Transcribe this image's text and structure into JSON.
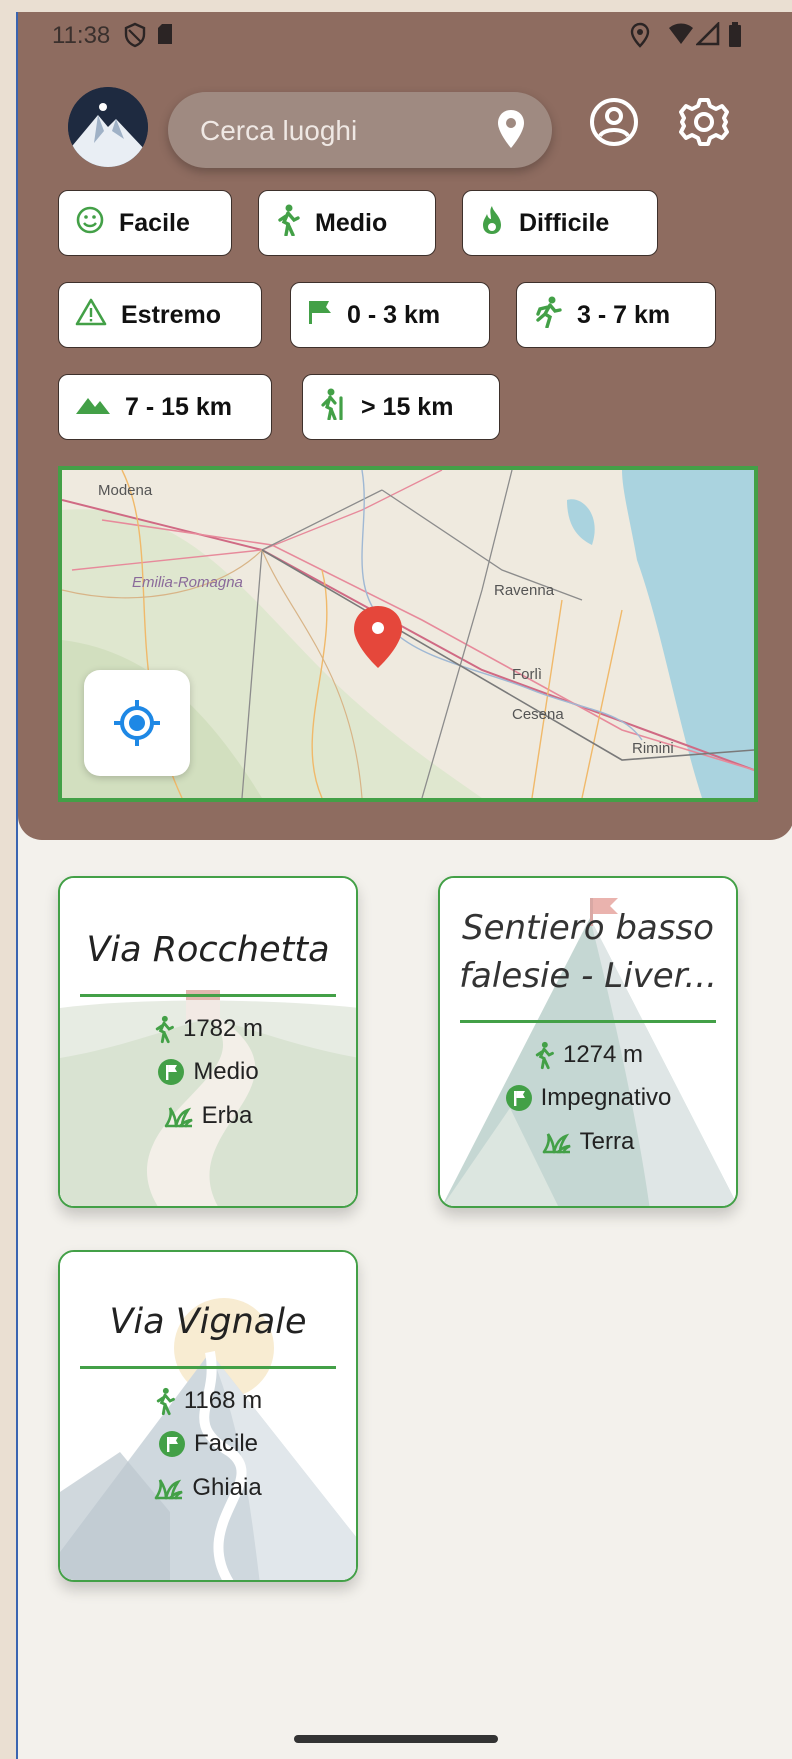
{
  "status_bar": {
    "time": "11:38"
  },
  "search": {
    "placeholder": "Cerca luoghi"
  },
  "filters": [
    {
      "label": "Facile",
      "icon": "smile-icon"
    },
    {
      "label": "Medio",
      "icon": "walk-icon"
    },
    {
      "label": "Difficile",
      "icon": "fire-icon"
    },
    {
      "label": "Estremo",
      "icon": "warning-icon"
    },
    {
      "label": "0 - 3 km",
      "icon": "flag-icon"
    },
    {
      "label": "3 - 7 km",
      "icon": "run-icon"
    },
    {
      "label": "7 - 15 km",
      "icon": "mountain-icon"
    },
    {
      "label": "> 15 km",
      "icon": "hike-icon"
    }
  ],
  "map": {
    "labels": [
      "Modena",
      "Emilia-Romagna",
      "Ravenna",
      "Forlì",
      "Cesena",
      "Rimini"
    ]
  },
  "trails": [
    {
      "name": "Via Rocchetta",
      "length": "1782 m",
      "difficulty": "Medio",
      "terrain": "Erba"
    },
    {
      "name": "Sentiero basso falesie - Liver...",
      "length": "1274 m",
      "difficulty": "Impegnativo",
      "terrain": "Terra"
    },
    {
      "name": "Via Vignale",
      "length": "1168 m",
      "difficulty": "Facile",
      "terrain": "Ghiaia"
    }
  ],
  "colors": {
    "header": "#8e6c60",
    "accent": "#43a047",
    "background": "#f3f1ec"
  }
}
